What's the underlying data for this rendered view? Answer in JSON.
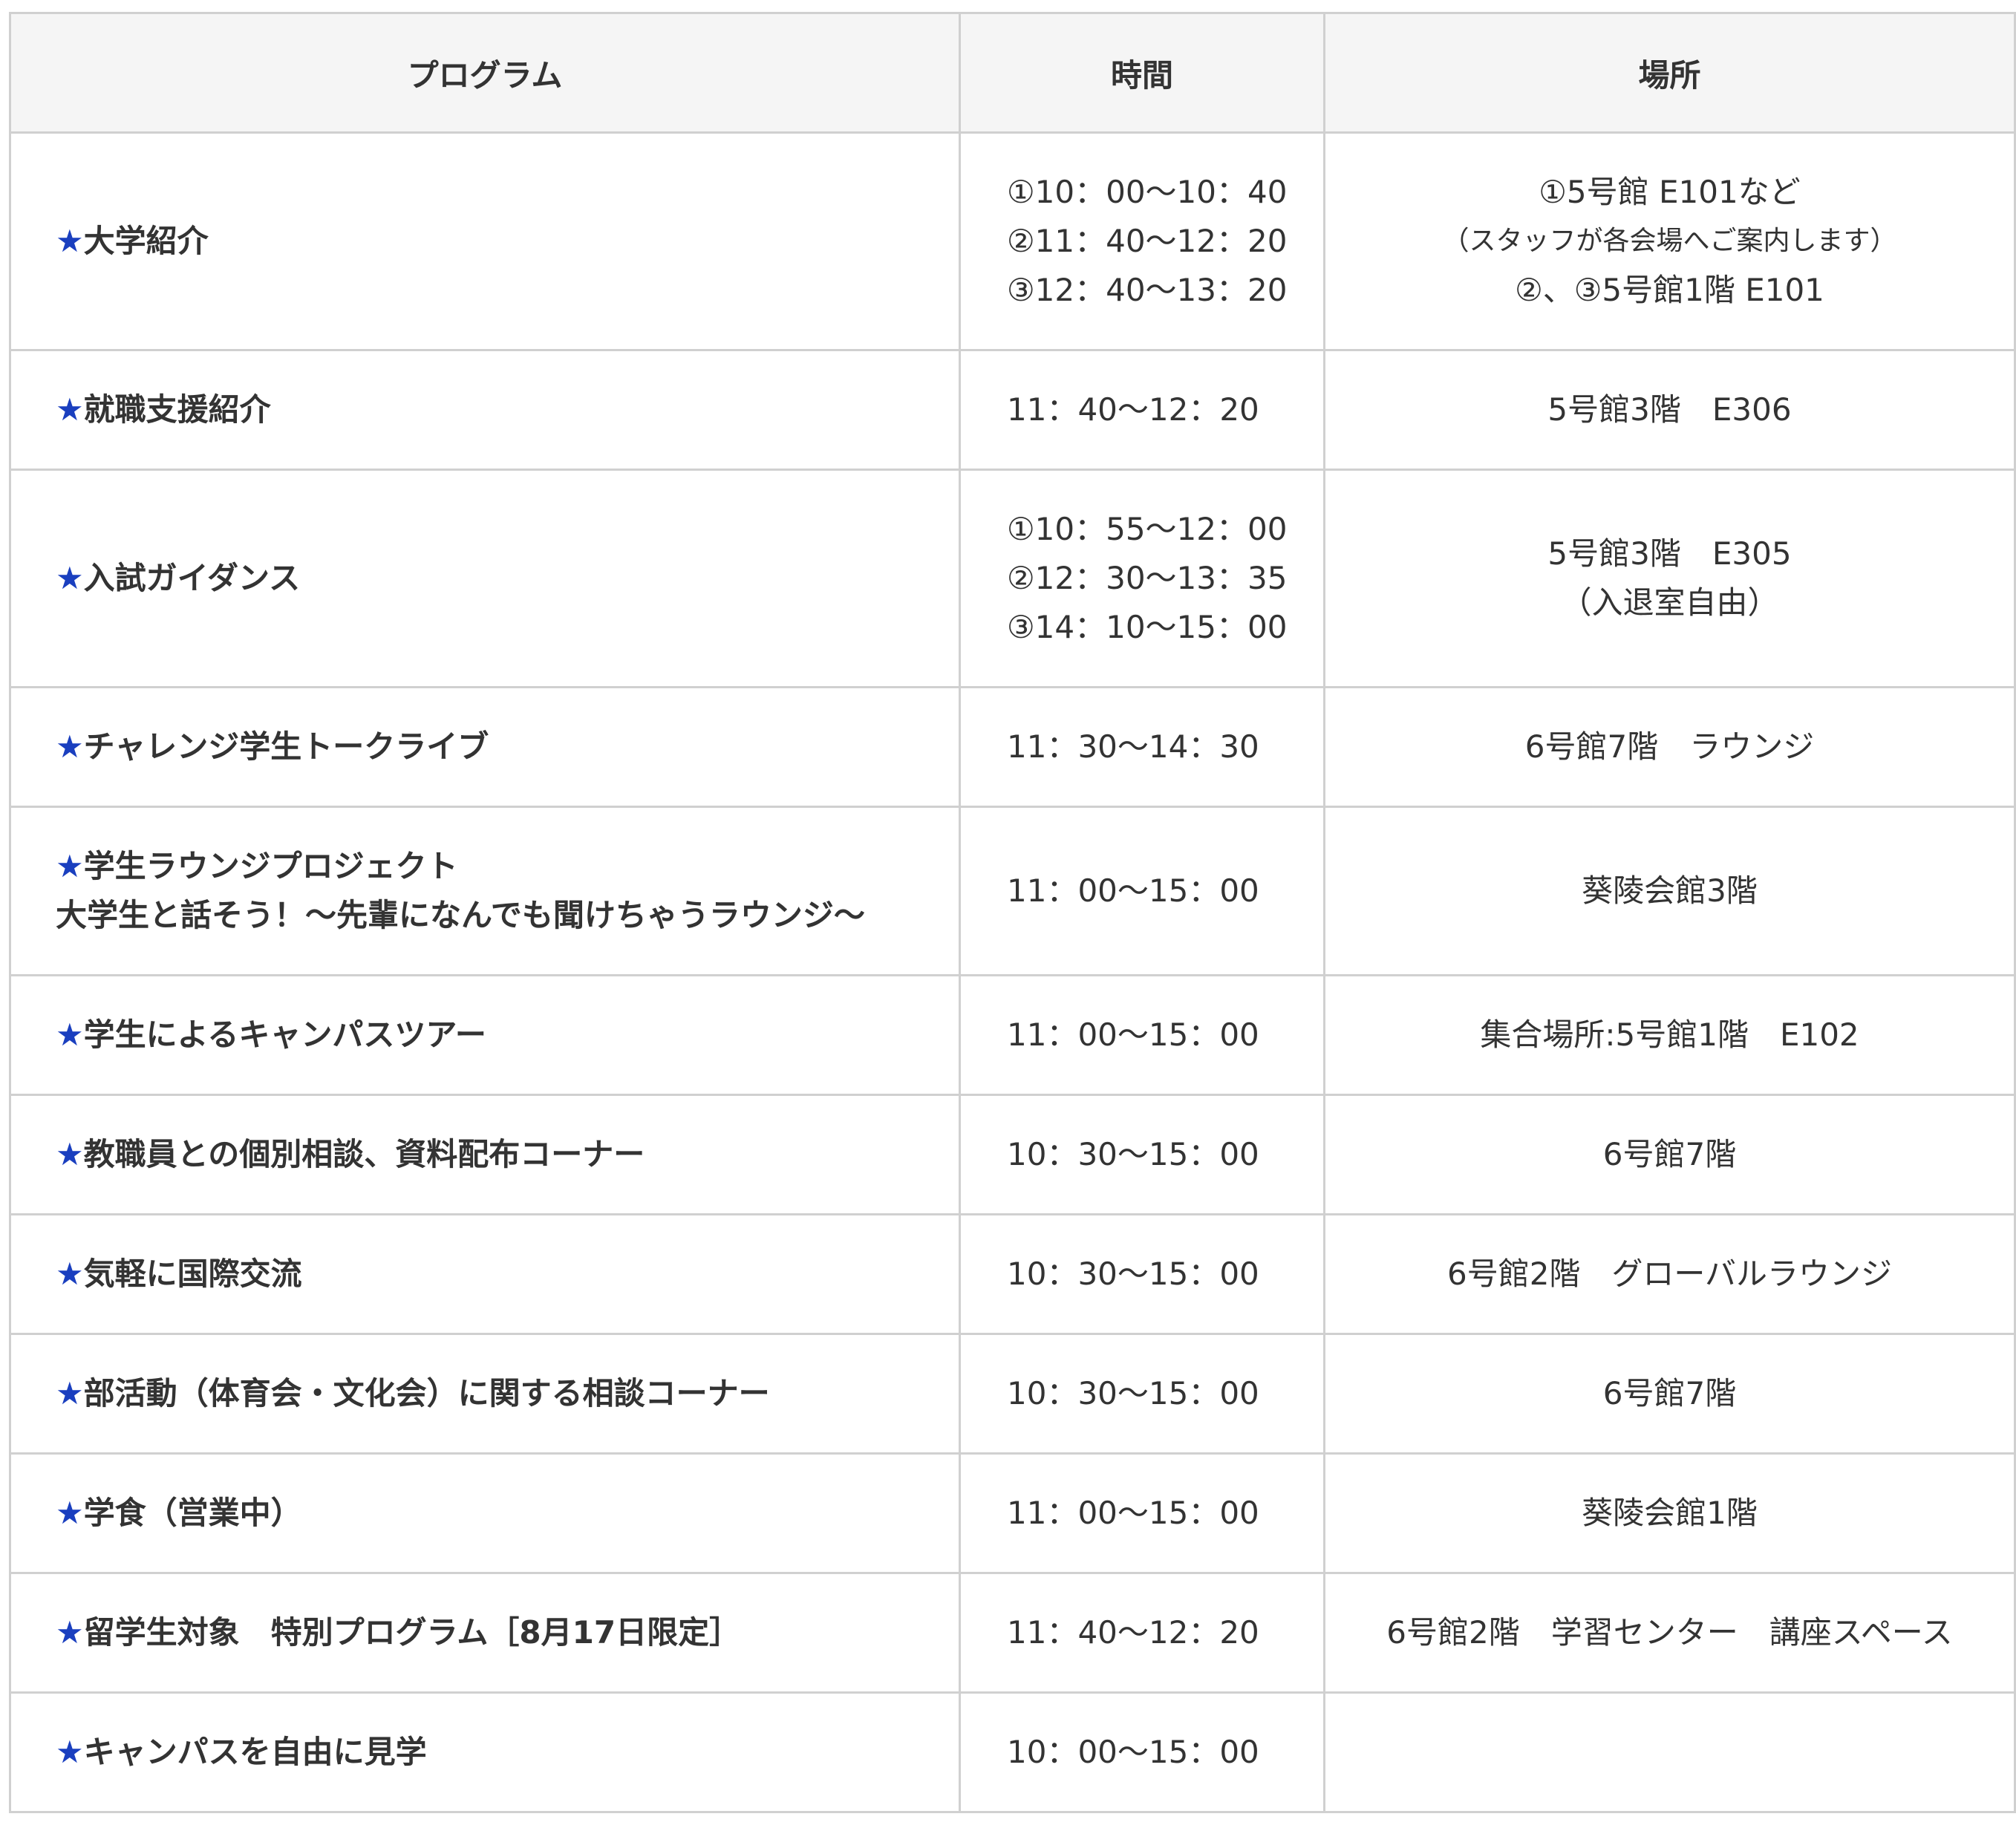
{
  "table": {
    "headers": {
      "program": "プログラム",
      "time": "時間",
      "place": "場所"
    },
    "star": "★",
    "rows": [
      {
        "program": [
          "大学紹介"
        ],
        "time": [
          "①10：00〜10：40",
          "②11：40〜12：20",
          "③12：40〜13：20"
        ],
        "place": [
          "①5号館 E101など",
          "（スタッフが各会場へご案内します）",
          "②、③5号館1階 E101"
        ]
      },
      {
        "program": [
          "就職支援紹介"
        ],
        "time": [
          "11：40〜12：20"
        ],
        "place": [
          "5号館3階　E306"
        ]
      },
      {
        "program": [
          "入試ガイダンス"
        ],
        "time": [
          "①10：55〜12：00",
          "②12：30〜13：35",
          "③14：10〜15：00"
        ],
        "place": [
          "5号館3階　E305",
          "（入退室自由）"
        ]
      },
      {
        "program": [
          "チャレンジ学生トークライブ"
        ],
        "time": [
          "11：30〜14：30"
        ],
        "place": [
          "6号館7階　ラウンジ"
        ]
      },
      {
        "program": [
          "学生ラウンジプロジェクト",
          "大学生と話そう！〜先輩になんでも聞けちゃうラウンジ〜"
        ],
        "time": [
          "11：00〜15：00"
        ],
        "place": [
          "葵陵会館3階"
        ]
      },
      {
        "program": [
          "学生によるキャンパスツアー"
        ],
        "time": [
          "11：00〜15：00"
        ],
        "place": [
          "集合場所:5号館1階　E102"
        ]
      },
      {
        "program": [
          "教職員との個別相談、資料配布コーナー"
        ],
        "time": [
          "10：30〜15：00"
        ],
        "place": [
          "6号館7階"
        ]
      },
      {
        "program": [
          "気軽に国際交流"
        ],
        "time": [
          "10：30〜15：00"
        ],
        "place": [
          "6号館2階　グローバルラウンジ"
        ]
      },
      {
        "program": [
          "部活動（体育会・文化会）に関する相談コーナー"
        ],
        "time": [
          "10：30〜15：00"
        ],
        "place": [
          "6号館7階"
        ]
      },
      {
        "program": [
          "学食（営業中）"
        ],
        "time": [
          "11：00〜15：00"
        ],
        "place": [
          "葵陵会館1階"
        ]
      },
      {
        "program": [
          "留学生対象　特別プログラム［8月17日限定］"
        ],
        "time": [
          "11：40〜12：20"
        ],
        "place": [
          "6号館2階　学習センター　講座スペース"
        ]
      },
      {
        "program": [
          "キャンパスを自由に見学"
        ],
        "time": [
          "10：00〜15：00"
        ],
        "place": []
      }
    ]
  },
  "colors": {
    "star": "#1a3fbf",
    "header_bg": "#f5f5f5",
    "border": "#d0d0d0",
    "text": "#333333"
  }
}
